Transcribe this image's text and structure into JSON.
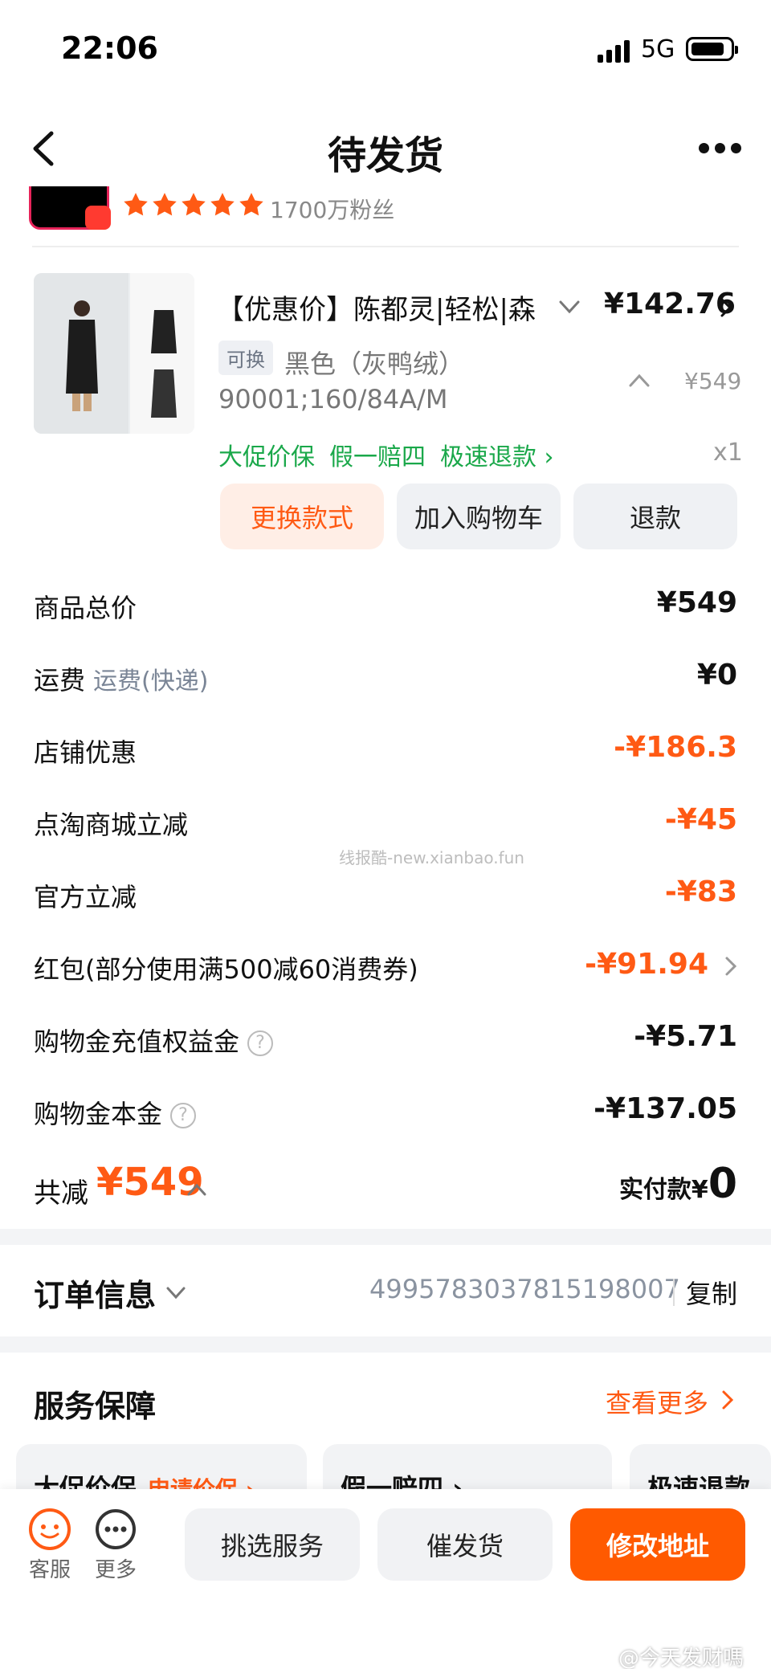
{
  "status": {
    "time": "22:06",
    "network": "5G"
  },
  "nav": {
    "title": "待发货"
  },
  "shop": {
    "fans": "1700万粉丝",
    "rating_stars": 5
  },
  "product": {
    "title": "【优惠价】陈都灵|轻松|森",
    "price": "¥142.76",
    "exchange_tag": "可换",
    "color": "黑色（灰鸭绒）",
    "size": "90001;160/84A/M",
    "original_price": "¥549",
    "guarantees": [
      "大促价保",
      "假一赔四",
      "极速退款 ›"
    ],
    "quantity": "x1",
    "buttons": {
      "exchange": "更换款式",
      "cart": "加入购物车",
      "refund": "退款"
    }
  },
  "price_lines": [
    {
      "label": "商品总价",
      "sub": "",
      "value": "¥549",
      "orange": false
    },
    {
      "label": "运费",
      "sub": "运费(快递)",
      "value": "¥0",
      "orange": false
    },
    {
      "label": "店铺优惠",
      "sub": "",
      "value": "-¥186.3",
      "orange": true
    },
    {
      "label": "点淘商城立减",
      "sub": "",
      "value": "-¥45",
      "orange": true
    },
    {
      "label": "官方立减",
      "sub": "",
      "value": "-¥83",
      "orange": true
    },
    {
      "label": "红包(部分使用满500减60消费券)",
      "sub": "",
      "value": "-¥91.94",
      "orange": true
    },
    {
      "label": "购物金充值权益金",
      "sub": "",
      "value": "-¥5.71",
      "orange": false
    },
    {
      "label": "购物金本金",
      "sub": "",
      "value": "-¥137.05",
      "orange": false
    }
  ],
  "total": {
    "label": "共减",
    "amount": "¥549",
    "paid_label": "实付款¥",
    "paid_value": "0"
  },
  "watermark": "线报酷-new.xianbao.fun",
  "order": {
    "title": "订单信息",
    "number": "4995783037815198007",
    "copy": "复制"
  },
  "service": {
    "title": "服务保障",
    "more": "查看更多",
    "cards": [
      {
        "title": "大促价保",
        "action": "申请价保 ›"
      },
      {
        "title": "假一赔四 ›",
        "action": ""
      },
      {
        "title": "极速退款",
        "action": ""
      }
    ]
  },
  "bottom": {
    "service_label": "客服",
    "more_label": "更多",
    "pick": "挑选服务",
    "urge": "催发货",
    "address": "修改地址"
  },
  "weibo_mark": "@今天发财嗎",
  "colors": {
    "accent": "#ff5a14",
    "green": "#1aa84a"
  }
}
